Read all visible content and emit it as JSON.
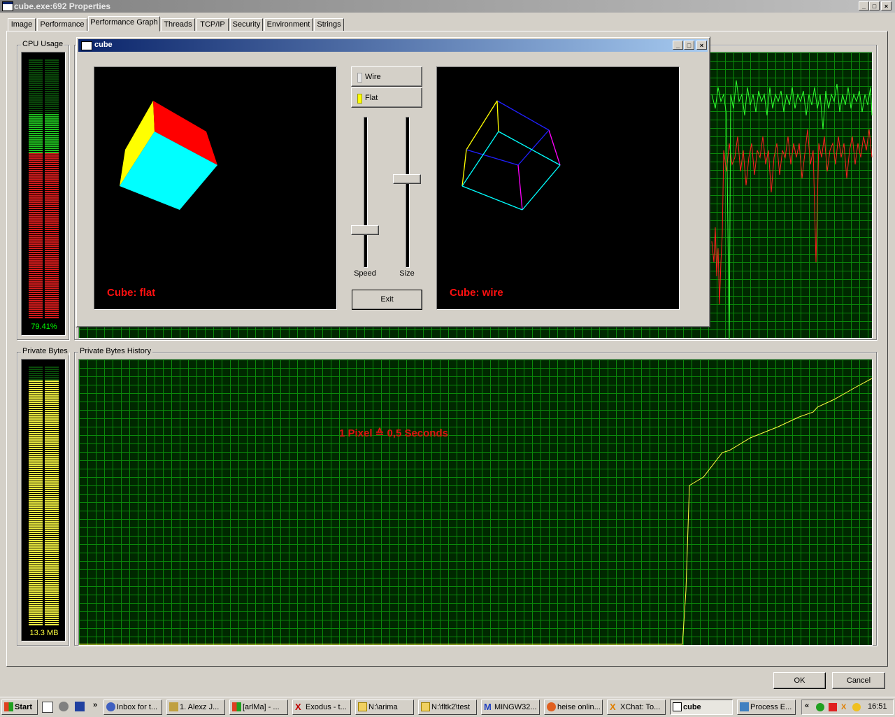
{
  "window": {
    "title": "cube.exe:692 Properties"
  },
  "tabs": [
    "Image",
    "Performance",
    "Performance Graph",
    "Threads",
    "TCP/IP",
    "Security",
    "Environment",
    "Strings"
  ],
  "selected_tab": "Performance Graph",
  "cpu": {
    "group_label": "CPU Usage",
    "value": "79.41%"
  },
  "private_bytes": {
    "group_label": "Private Bytes",
    "value": "13.3 MB",
    "history_label": "Private Bytes History",
    "scale_note": "1 Pixel ≙ 0,5 Seconds"
  },
  "cube_window": {
    "title": "cube",
    "wire_label": "Wire",
    "flat_label": "Flat",
    "speed_label": "Speed",
    "size_label": "Size",
    "exit_label": "Exit",
    "left_caption": "Cube: flat",
    "right_caption": "Cube: wire",
    "speed_level": 0.25,
    "size_level": 0.6
  },
  "dialog_buttons": {
    "ok": "OK",
    "cancel": "Cancel"
  },
  "taskbar": {
    "start": "Start",
    "items": [
      "Inbox for t...",
      "1. Alexz J...",
      "[arlMa] - ...",
      "Exodus - t...",
      "N:\\arima",
      "N:\\fltk2\\test",
      "MINGW32...",
      "heise onlin...",
      "XChat: To...",
      "cube",
      "Process E..."
    ],
    "active": "cube",
    "clock": "16:51"
  },
  "colors": {
    "cpu_meter": "#ff0000",
    "cpu_meter_top": "#00ff00",
    "bytes_meter": "#ffff00",
    "caption": "#ff0000",
    "graph_grid": "#0a8a0a"
  }
}
